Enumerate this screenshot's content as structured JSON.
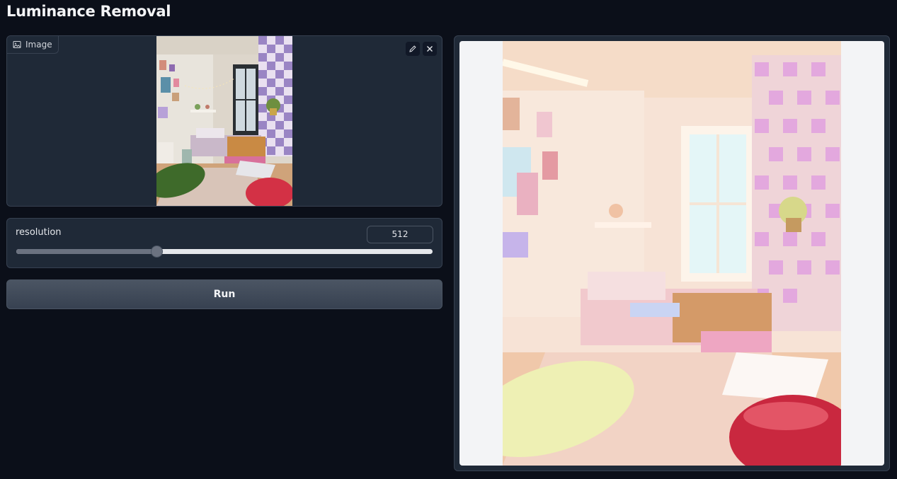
{
  "app": {
    "title": "Luminance Removal"
  },
  "input_image": {
    "label": "Image",
    "icon": "image-icon",
    "tools": [
      "pencil-icon",
      "close-icon"
    ]
  },
  "slider": {
    "label": "resolution",
    "value": "512",
    "fraction": 0.336
  },
  "run": {
    "label": "Run"
  },
  "output_image": {
    "icon": "output-image"
  }
}
